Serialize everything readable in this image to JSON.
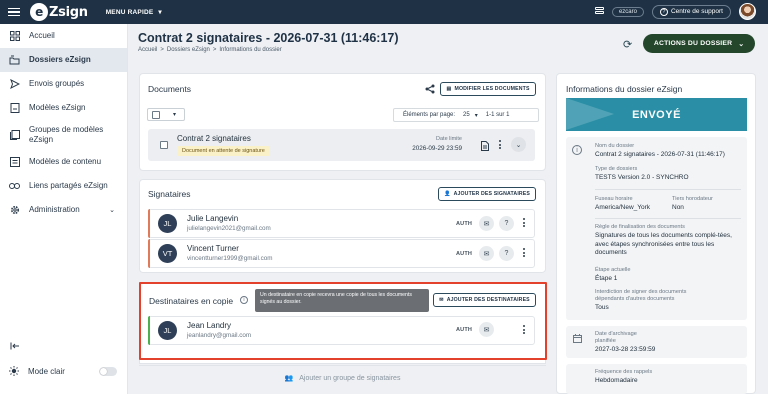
{
  "topbar": {
    "logo": "eZsign",
    "menu_rapide": "MENU RAPIDE",
    "user_chip": "ezcaro",
    "support": "Centre de support"
  },
  "sidebar": {
    "items": [
      {
        "label": "Accueil",
        "icon": "home-icon"
      },
      {
        "label": "Dossiers eZsign",
        "icon": "folder-icon",
        "active": true
      },
      {
        "label": "Envois groupés",
        "icon": "send-icon"
      },
      {
        "label": "Modèles eZsign",
        "icon": "template-icon"
      },
      {
        "label": "Groupes de modèles eZsign",
        "icon": "template-group-icon"
      },
      {
        "label": "Modèles de contenu",
        "icon": "content-template-icon"
      },
      {
        "label": "Liens partagés eZsign",
        "icon": "link-icon"
      },
      {
        "label": "Administration",
        "icon": "gear-icon"
      }
    ],
    "mode_label": "Mode clair"
  },
  "header": {
    "title": "Contrat 2 signataires - 2026-07-31 (11:46:17)",
    "breadcrumb": [
      "Accueil",
      "Dossiers eZsign",
      "Informations du dossier"
    ],
    "actions_label": "ACTIONS DU DOSSIER"
  },
  "documents": {
    "title": "Documents",
    "modify_label": "MODIFIER LES DOCUMENTS",
    "per_page_label": "Éléments par page:",
    "per_page_value": "25",
    "range": "1-1 sur 1",
    "row": {
      "name": "Contrat 2 signataires",
      "status": "Document en attente de signature",
      "deadline_label": "Date limite",
      "deadline_value": "2026-09-29 23:59"
    }
  },
  "signataires": {
    "title": "Signataires",
    "add_label": "AJOUTER DES SIGNATAIRES",
    "rows": [
      {
        "initials": "JL",
        "name": "Julie Langevin",
        "email": "julielangevin2021@gmail.com",
        "auth": "AUTH",
        "bar_color": "#e07b5a"
      },
      {
        "initials": "VT",
        "name": "Vincent Turner",
        "email": "vincentturner1999@gmail.com",
        "auth": "AUTH",
        "bar_color": "#e07b5a"
      }
    ]
  },
  "destinataires": {
    "title": "Destinataires en copie",
    "tooltip": "Un destinataire en copie recevra une copie de tous les documents signés au dossier.",
    "add_label": "AJOUTER DES DESTINATAIRES",
    "row": {
      "initials": "JL",
      "name": "Jean Landry",
      "email": "jeanlandry@gmail.com",
      "auth": "AUTH",
      "bar_color": "#4caf50"
    },
    "add_group": "Ajouter un groupe de signataires"
  },
  "info": {
    "title": "Informations du dossier eZsign",
    "status": "ENVOYÉ",
    "nom_label": "Nom du dossier",
    "nom_value": "Contrat 2 signataires - 2026-07-31 (11:46:17)",
    "type_label": "Type de dossiers",
    "type_value": "TESTS Version 2.0 - SYNCHRO",
    "fuseau_label": "Fuseau horaire",
    "fuseau_value": "America/New_York",
    "tiers_label": "Tiers horodateur",
    "tiers_value": "Non",
    "regle_label": "Règle de finalisation des documents",
    "regle_value": "Signatures de tous les documents complé-tées, avec étapes synchronisées entre tous les documents",
    "etape_label": "Étape actuelle",
    "etape_value": "Étape 1",
    "interdiction_label": "Interdiction de signer des documents dépendants d'autres documents",
    "interdiction_value": "Tous",
    "archivage_label": "Date d'archivage planifiée",
    "archivage_value": "2027-03-28 23:59:59",
    "rappels_label": "Fréquence des rappels",
    "rappels_value": "Hebdomadaire"
  }
}
